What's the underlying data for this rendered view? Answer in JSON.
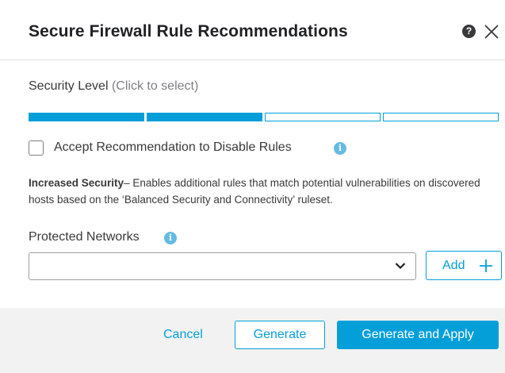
{
  "dialog": {
    "title": "Secure Firewall Rule Recommendations",
    "help_icon": "question-circle-icon",
    "close_icon": "close-icon"
  },
  "security_level": {
    "label": "Security Level",
    "hint": "(Click to select)",
    "total_levels": 4,
    "selected_level": 2,
    "accent_color": "#049fd9"
  },
  "disable_rules": {
    "label": "Accept Recommendation to Disable Rules",
    "checked": false,
    "info_icon": "info-icon"
  },
  "description": {
    "heading": "Increased Security",
    "text": "– Enables additional rules that match potential vulnerabilities on discovered hosts based on the ‘Balanced Security and Connectivity’ ruleset."
  },
  "protected_networks": {
    "label": "Protected Networks",
    "info_icon": "info-icon",
    "selected_value": "",
    "dropdown_icon": "chevron-down-icon",
    "add_label": "Add",
    "add_icon": "plus-icon"
  },
  "footer": {
    "cancel_label": "Cancel",
    "generate_label": "Generate",
    "generate_apply_label": "Generate and Apply"
  }
}
